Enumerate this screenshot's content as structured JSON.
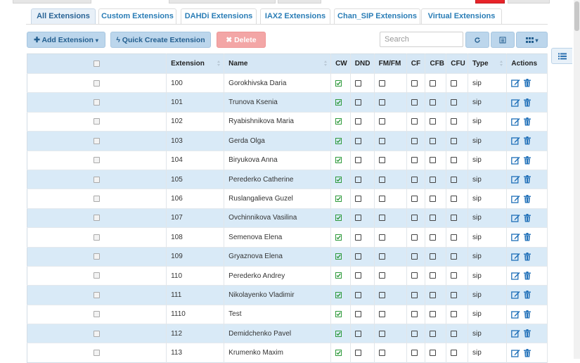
{
  "tabs": [
    {
      "label": "All Extensions",
      "active": true
    },
    {
      "label": "Custom Extensions",
      "active": false
    },
    {
      "label": "DAHDi Extensions",
      "active": false
    },
    {
      "label": "IAX2 Extensions",
      "active": false
    },
    {
      "label": "Chan_SIP Extensions",
      "active": false
    },
    {
      "label": "Virtual Extensions",
      "active": false
    }
  ],
  "toolbar": {
    "add_label": "Add Extension",
    "quick_label": "Quick Create Extension",
    "delete_label": "Delete",
    "search_placeholder": "Search",
    "icons": [
      "refresh-icon",
      "list-view-icon",
      "columns-icon"
    ]
  },
  "table": {
    "columns": [
      "",
      "Extension",
      "Name",
      "CW",
      "DND",
      "FM/FM",
      "CF",
      "CFB",
      "CFU",
      "Type",
      "Actions"
    ],
    "rows": [
      {
        "extension": "100",
        "name": "Gorokhivska Daria",
        "cw": true,
        "type": "sip"
      },
      {
        "extension": "101",
        "name": "Trunova Ksenia",
        "cw": true,
        "type": "sip"
      },
      {
        "extension": "102",
        "name": "Ryabishnikova Maria",
        "cw": true,
        "type": "sip"
      },
      {
        "extension": "103",
        "name": "Gerda Olga",
        "cw": true,
        "type": "sip"
      },
      {
        "extension": "104",
        "name": "Biryukova Anna",
        "cw": true,
        "type": "sip"
      },
      {
        "extension": "105",
        "name": "Perederko Catherine",
        "cw": true,
        "type": "sip"
      },
      {
        "extension": "106",
        "name": "Ruslangalieva Guzel",
        "cw": true,
        "type": "sip"
      },
      {
        "extension": "107",
        "name": "Ovchinnikova Vasilina",
        "cw": true,
        "type": "sip"
      },
      {
        "extension": "108",
        "name": "Semenova Elena",
        "cw": true,
        "type": "sip"
      },
      {
        "extension": "109",
        "name": "Gryaznova Elena",
        "cw": true,
        "type": "sip"
      },
      {
        "extension": "110",
        "name": "Perederko Andrey",
        "cw": true,
        "type": "sip"
      },
      {
        "extension": "111",
        "name": "Nikolayenko Vladimir",
        "cw": true,
        "type": "sip"
      },
      {
        "extension": "1110",
        "name": "Test",
        "cw": true,
        "type": "sip"
      },
      {
        "extension": "112",
        "name": "Demidchenko Pavel",
        "cw": true,
        "type": "sip"
      },
      {
        "extension": "113",
        "name": "Krumenko Maxim",
        "cw": true,
        "type": "sip"
      }
    ]
  },
  "colors": {
    "tab_text": "#2a7db6",
    "header_bg": "#d6e7f5",
    "row_alt_bg": "#d9eaf7",
    "button_blue": "#bcd6ec",
    "button_red": "#f3a6a6",
    "check_green": "#2e9a3c",
    "action_blue": "#1e6fb8"
  }
}
